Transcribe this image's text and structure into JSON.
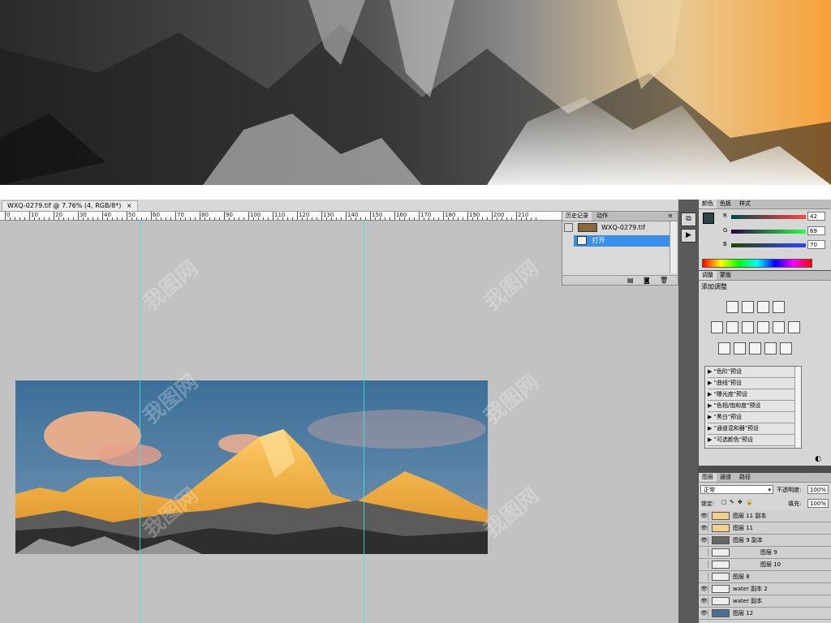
{
  "document_tab": {
    "title": "WXQ-0279.tif @ 7.76% (4, RGB/8*)",
    "close": "×"
  },
  "ruler": {
    "labels": [
      "0",
      "10",
      "20",
      "30",
      "40",
      "50",
      "60",
      "70",
      "80",
      "90",
      "100",
      "110",
      "120",
      "130",
      "140",
      "150",
      "160",
      "170",
      "180",
      "190",
      "200",
      "210"
    ]
  },
  "history_panel": {
    "tabs": [
      "历史记录",
      "动作"
    ],
    "snapshot_name": "WXQ-0279.tif",
    "steps": [
      "打开"
    ]
  },
  "color_panel": {
    "tabs": [
      "颜色",
      "色板",
      "样式"
    ],
    "channels": [
      {
        "label": "R",
        "value": "42"
      },
      {
        "label": "G",
        "value": "69"
      },
      {
        "label": "B",
        "value": "70"
      }
    ],
    "foreground_color": "#2a4546"
  },
  "adjustments_panel": {
    "tabs": [
      "调整",
      "蒙版"
    ],
    "heading": "添加调整",
    "presets": [
      "\"色阶\"预设",
      "\"曲线\"预设",
      "\"曝光度\"预设",
      "\"色相/饱和度\"预设",
      "\"黑白\"预设",
      "\"通道混和器\"预设",
      "\"可选颜色\"预设"
    ]
  },
  "layers_panel": {
    "tabs": [
      "图层",
      "通道",
      "路径"
    ],
    "blend_mode": "正常",
    "opacity_label": "不透明度:",
    "opacity_value": "100%",
    "lock_label": "锁定:",
    "fill_label": "填充:",
    "fill_value": "100%",
    "layers": [
      {
        "name": "图层 11 副本",
        "visible": true
      },
      {
        "name": "图层 11",
        "visible": true
      },
      {
        "name": "图层 9 副本",
        "visible": true
      },
      {
        "name": "图层 9",
        "visible": false
      },
      {
        "name": "图层 10",
        "visible": false
      },
      {
        "name": "图层 8",
        "visible": false
      },
      {
        "name": "water 副本 2",
        "visible": true
      },
      {
        "name": "water 副本",
        "visible": true
      },
      {
        "name": "图层 12",
        "visible": true
      }
    ]
  },
  "watermark_text": "我图网"
}
